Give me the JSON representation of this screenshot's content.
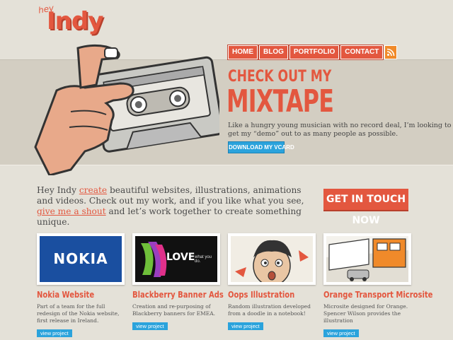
{
  "logo": {
    "hey": "hey",
    "name": "Indy"
  },
  "nav": {
    "items": [
      "HOME",
      "BLOG",
      "PORTFOLIO",
      "CONTACT"
    ],
    "rss_icon": "rss-icon"
  },
  "hero": {
    "title_line1": "CHECK OUT MY",
    "title_line2": "MIXTAPE",
    "text": "Like a hungry young musician with no record deal, I’m looking to get my “demo” out to as many people as possible.",
    "button": "DOWNLOAD MY VCARD"
  },
  "intro": {
    "part1": "Hey Indy ",
    "link1": "create",
    "part2": " beautiful websites, illustrations, animations and videos. Check out my work, and if you like what you see, ",
    "link2": "give me a shout",
    "part3": " and let’s work together to create something unique."
  },
  "cta": "GET IN TOUCH NOW",
  "cards": [
    {
      "title": "Nokia Website",
      "desc": "Part of a team for the full redesign of the Nokia website, first release in Ireland.",
      "button": "view project",
      "logo_text": "NOKIA"
    },
    {
      "title": "Blackberry Banner Ads",
      "desc": "Creation and re-purposing of Blackberry banners for EMEA.",
      "button": "view project",
      "logo_text": "LOVE",
      "tagline": "what you do."
    },
    {
      "title": "Oops Illustration",
      "desc": "Random illustration developed from a doodle in a notebook!",
      "button": "view project"
    },
    {
      "title": "Orange Transport Microsite",
      "desc": "Microsite designed for Orange. Spencer Wilson provides the illustration",
      "button": "view project"
    }
  ],
  "colors": {
    "accent": "#e3573f",
    "blue": "#2ba3dc",
    "background": "#e4e1d8"
  }
}
